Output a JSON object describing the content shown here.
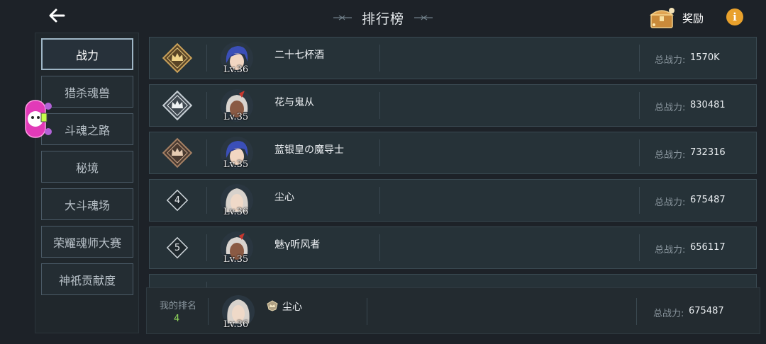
{
  "header": {
    "title": "排行榜",
    "reward_label": "奖励",
    "info_glyph": "i",
    "icons": [
      "back-arrow-icon",
      "treasure-chest-icon",
      "info-icon"
    ]
  },
  "sidebar": {
    "tabs": [
      {
        "label": "战力",
        "active": true
      },
      {
        "label": "猎杀魂兽",
        "active": false
      },
      {
        "label": "斗魂之路",
        "active": false
      },
      {
        "label": "秘境",
        "active": false
      },
      {
        "label": "大斗魂场",
        "active": false
      },
      {
        "label": "荣耀魂师大赛",
        "active": false
      },
      {
        "label": "神祇贡献度",
        "active": false
      }
    ]
  },
  "ranking": {
    "power_label": "总战力:",
    "rows": [
      {
        "rank": "1",
        "badge": "gold-crown-badge",
        "level": "Lv.36",
        "name": "二十七杯酒",
        "power": "1570K"
      },
      {
        "rank": "2",
        "badge": "silver-crown-badge",
        "level": "Lv.35",
        "name": "花与鬼从",
        "power": "830481"
      },
      {
        "rank": "3",
        "badge": "bronze-crown-badge",
        "level": "Lv.35",
        "name": "蓝银皇の魔导士",
        "power": "732316"
      },
      {
        "rank": "4",
        "badge": "number-diamond-badge",
        "level": "Lv.36",
        "name": "尘心",
        "power": "675487"
      },
      {
        "rank": "5",
        "badge": "number-diamond-badge",
        "level": "Lv.35",
        "name": "魅γ听风者",
        "power": "656117"
      }
    ]
  },
  "my_rank": {
    "label": "我的排名",
    "value": "4",
    "level": "Lv.36",
    "name": "尘心",
    "power_label": "总战力:",
    "power": "675487"
  },
  "colors": {
    "background": "#1d2228",
    "row_bg": "#263238",
    "gold": "#c9a15a",
    "silver": "#c8d0d6",
    "bronze": "#a58064",
    "rank_green": "#8fd45a",
    "info_orange": "#e9a12c"
  }
}
